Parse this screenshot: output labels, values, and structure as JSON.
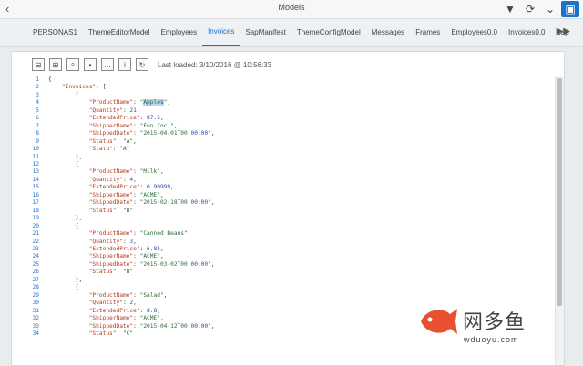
{
  "window": {
    "title": "Models",
    "back_icon": "chevron-left",
    "actions": [
      {
        "icon": "filter-icon",
        "glyph": "▼"
      },
      {
        "icon": "refresh-icon",
        "glyph": "⟳"
      },
      {
        "icon": "collapse-icon",
        "glyph": "⌄"
      },
      {
        "icon": "panel-icon",
        "glyph": "▣"
      }
    ]
  },
  "tabs": {
    "items": [
      "PERSONAS1",
      "ThemeEditorModel",
      "Employees",
      "Invoices",
      "SapManifest",
      "ThemeConfigModel",
      "Messages",
      "Frames",
      "Employees0.0",
      "Invoices0.0",
      "Sap"
    ],
    "active": 3,
    "more_glyph": "▶▶"
  },
  "toolbar": {
    "buttons": [
      {
        "icon": "collapse-all-icon",
        "glyph": "⊟"
      },
      {
        "icon": "expand-all-icon",
        "glyph": "⊞"
      },
      {
        "icon": "search-icon",
        "glyph": "⌕"
      },
      {
        "icon": "save-icon",
        "glyph": "▪"
      },
      {
        "icon": "more-icon",
        "glyph": "…"
      },
      {
        "icon": "info-icon",
        "glyph": "i"
      },
      {
        "icon": "reload-icon",
        "glyph": "↻"
      }
    ],
    "last_loaded": "Last loaded: 3/10/2016 @ 10:56:33"
  },
  "editor": {
    "lines": [
      "{",
      "    \"Invoices\": [",
      "        {",
      "            \"ProductName\": \"Apples\",",
      "            \"Quantity\": 21,",
      "            \"ExtendedPrice\": 87.2,",
      "            \"ShipperName\": \"Fun Inc.\",",
      "            \"ShippedDate\": \"2015-04-01T00:00:00\",",
      "            \"Status\": \"A\",",
      "            \"Statu\": \"A\"",
      "        },",
      "        {",
      "            \"ProductName\": \"Milk\",",
      "            \"Quantity\": 4,",
      "            \"ExtendedPrice\": 0.99999,",
      "            \"ShipperName\": \"ACME\",",
      "            \"ShippedDate\": \"2015-02-18T00:00:00\",",
      "            \"Status\": \"B\"",
      "        },",
      "        {",
      "            \"ProductName\": \"Canned Beans\",",
      "            \"Quantity\": 3,",
      "            \"ExtendedPrice\": 6.85,",
      "            \"ShipperName\": \"ACME\",",
      "            \"ShippedDate\": \"2015-03-02T00:00:00\",",
      "            \"Status\": \"B\"",
      "        },",
      "        {",
      "            \"ProductName\": \"Salad\",",
      "            \"Quantity\": 2,",
      "            \"ExtendedPrice\": 8.8,",
      "            \"ShipperName\": \"ACME\",",
      "            \"ShippedDate\": \"2015-04-12T00:00:00\",",
      "            \"Status\": \"C\""
    ],
    "selected_word": "Apples",
    "selected_line": 4
  },
  "watermark": {
    "brand_cn": "网多鱼",
    "url": "wduoyu.com",
    "color": "#e8512f"
  },
  "colors": {
    "accent": "#1a73c4",
    "line_numbers": "#2a72c8"
  }
}
